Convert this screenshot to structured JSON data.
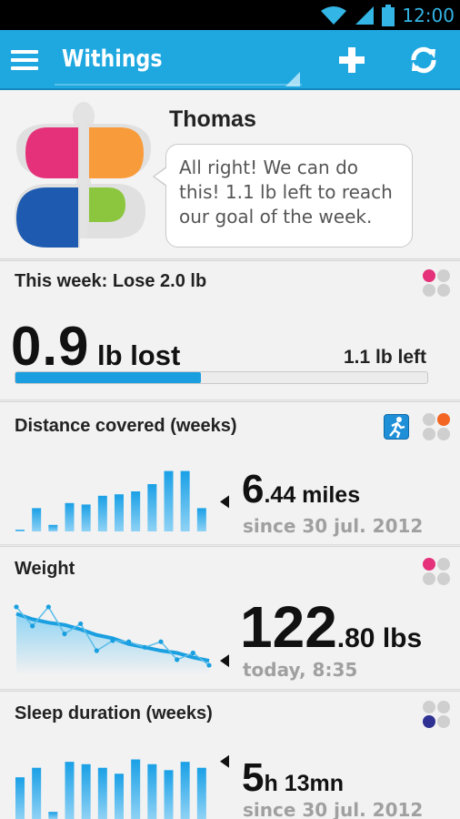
{
  "status_bar": {
    "time": "12:00",
    "icons": [
      "wifi-icon",
      "signal-icon",
      "battery-icon"
    ]
  },
  "action_bar": {
    "title": "Withings",
    "add_icon": "plus-icon",
    "refresh_icon": "refresh-icon",
    "menu_icon": "hamburger-icon"
  },
  "profile": {
    "name": "Thomas",
    "message": "All right! We can do this! 1.1 lb left to reach our goal of the week."
  },
  "goal": {
    "title": "This week: Lose 2.0 lb",
    "value": "0.9",
    "unit": " lb lost",
    "left": "1.1 lb left",
    "progress": 0.45,
    "accent": "#e5317a"
  },
  "distance": {
    "title": "Distance covered (weeks)",
    "value_int": "6",
    "value_dec": ".44 miles",
    "since": "since 30 jul. 2012",
    "accent": "#f26522"
  },
  "weight": {
    "title": "Weight",
    "value_int": "122",
    "value_dec": ".80 lbs",
    "since": "today, 8:35",
    "accent": "#e5317a"
  },
  "sleep": {
    "title": "Sleep duration (weeks)",
    "value_int": "5",
    "value_dec": "h 13mn",
    "since": "since 30 jul. 2012",
    "accent": "#2e3192"
  },
  "chart_data": [
    {
      "type": "bar",
      "title": "Distance covered (weeks)",
      "values": [
        0.2,
        3.2,
        0.9,
        3.9,
        3.7,
        4.9,
        5.1,
        5.5,
        6.5,
        8.3,
        8.3,
        3.2
      ],
      "ylim": [
        0,
        9
      ]
    },
    {
      "type": "line",
      "title": "Weight",
      "series": [
        {
          "values": [
            126.0,
            125.5,
            125.2,
            125.0,
            124.6,
            124.1,
            123.8,
            123.3,
            123.0,
            122.7,
            122.5,
            122.1,
            121.8
          ]
        },
        {
          "values": [
            126.6,
            124.9,
            126.6,
            124.2,
            125.1,
            122.7,
            123.6,
            123.5,
            123.0,
            123.5,
            121.9,
            122.5,
            121.4
          ]
        }
      ],
      "ylim": [
        121,
        127
      ]
    },
    {
      "type": "bar",
      "title": "Sleep duration (weeks)",
      "values": [
        3.5,
        4.3,
        0.6,
        4.8,
        4.6,
        4.3,
        3.8,
        5.0,
        4.6,
        4.1,
        4.8,
        4.3
      ],
      "ylim": [
        0,
        5.5
      ]
    }
  ]
}
